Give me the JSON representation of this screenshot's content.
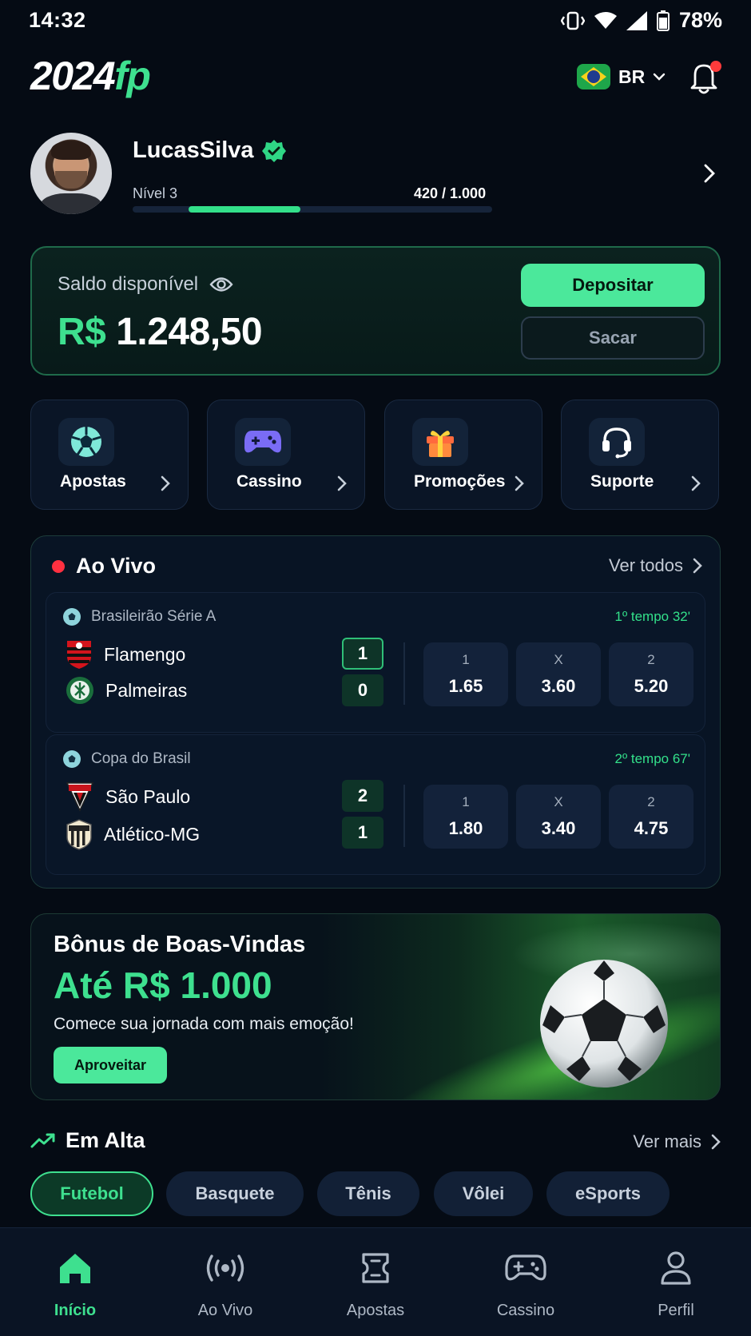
{
  "status_bar": {
    "time": "14:32",
    "battery": "78%"
  },
  "header": {
    "logo_main": "2024",
    "logo_accent": "fp",
    "country_code": "BR"
  },
  "profile": {
    "username": "LucasSilva",
    "level": "Nível 3",
    "xp": "420 / 1.000",
    "xp_progress": 0.42
  },
  "balance": {
    "label": "Saldo disponível",
    "currency": "R$",
    "amount": "1.248,50",
    "deposit": "Depositar",
    "withdraw": "Sacar"
  },
  "quick_actions": [
    {
      "label": "Apostas",
      "icon": "soccer-ball-icon"
    },
    {
      "label": "Cassino",
      "icon": "gamepad-icon"
    },
    {
      "label": "Promoções",
      "icon": "gift-icon"
    },
    {
      "label": "Suporte",
      "icon": "headset-icon"
    }
  ],
  "live": {
    "title": "Ao Vivo",
    "see_all": "Ver todos",
    "matches": [
      {
        "league": "Brasileirão Série A",
        "time": "1º tempo 32'",
        "home": "Flamengo",
        "away": "Palmeiras",
        "home_score": "1",
        "away_score": "0",
        "odds": [
          {
            "label": "1",
            "value": "1.65"
          },
          {
            "label": "X",
            "value": "3.60"
          },
          {
            "label": "2",
            "value": "5.20"
          }
        ]
      },
      {
        "league": "Copa do Brasil",
        "time": "2º tempo 67'",
        "home": "São Paulo",
        "away": "Atlético-MG",
        "home_score": "2",
        "away_score": "1",
        "odds": [
          {
            "label": "1",
            "value": "1.80"
          },
          {
            "label": "X",
            "value": "3.40"
          },
          {
            "label": "2",
            "value": "4.75"
          }
        ]
      }
    ]
  },
  "promo": {
    "title": "Bônus de Boas-Vindas",
    "amount": "Até R$ 1.000",
    "subtitle": "Comece sua jornada com mais emoção!",
    "cta": "Aproveitar"
  },
  "trending": {
    "title": "Em Alta",
    "see_more": "Ver mais",
    "chips": [
      "Futebol",
      "Basquete",
      "Tênis",
      "Vôlei",
      "eSports"
    ],
    "active_chip": "Futebol"
  },
  "bottom_nav": [
    {
      "label": "Início",
      "icon": "home-icon",
      "active": true
    },
    {
      "label": "Ao Vivo",
      "icon": "broadcast-icon",
      "active": false
    },
    {
      "label": "Apostas",
      "icon": "ticket-icon",
      "active": false
    },
    {
      "label": "Cassino",
      "icon": "gamepad-icon",
      "active": false
    },
    {
      "label": "Perfil",
      "icon": "user-icon",
      "active": false
    }
  ],
  "colors": {
    "accent": "#3ee08f",
    "background": "#050b14",
    "live_dot": "#ff3040",
    "card": "#0a1526"
  }
}
